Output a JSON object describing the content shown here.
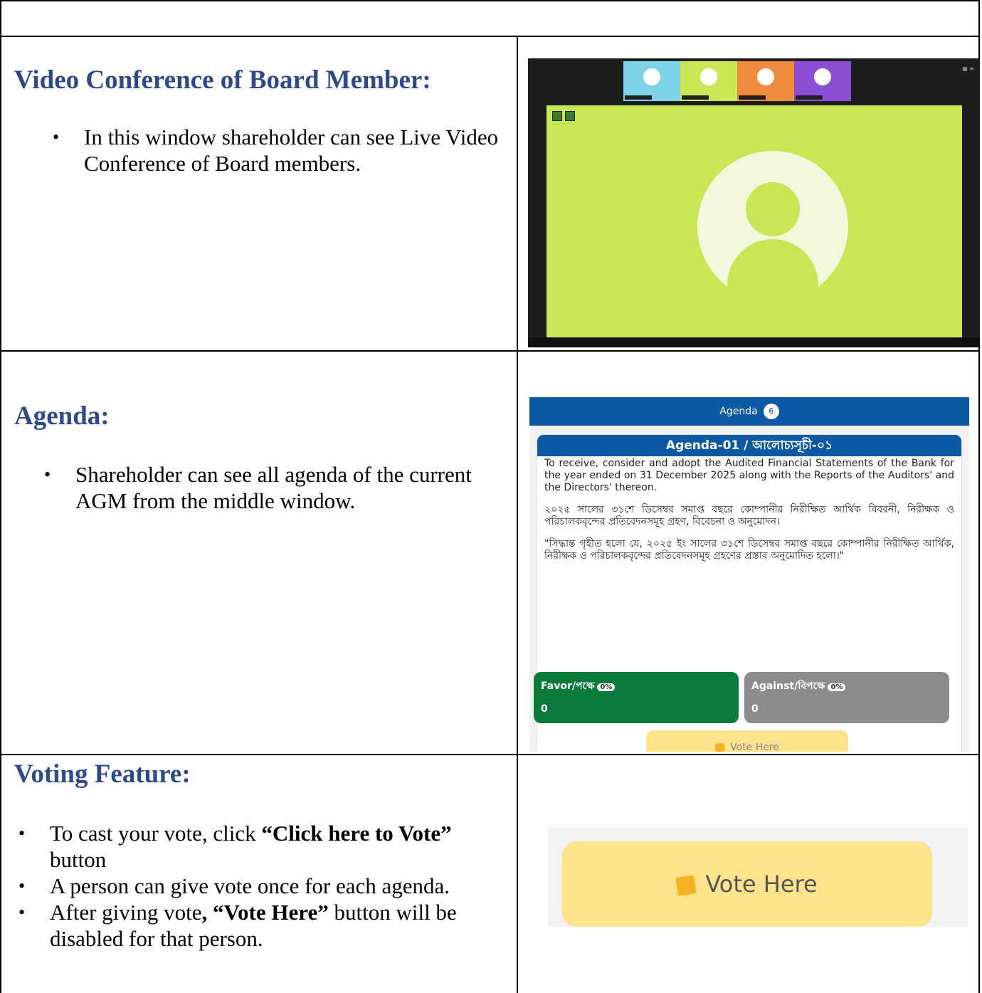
{
  "sections": [
    {
      "title": "Video Conference of Board Member:",
      "bullets": [
        "In this window shareholder can see Live Video Conference of Board members."
      ]
    },
    {
      "title": "Agenda:",
      "bullets": [
        "Shareholder can see all agenda of the current AGM from the middle window."
      ]
    },
    {
      "title": "Voting Feature:",
      "bullets": [
        [
          "To cast your vote, click ",
          "“Click here to Vote”",
          " button"
        ],
        "A person can give vote once for each agenda.",
        [
          "After giving vote",
          ", “Vote Here”",
          " button will be disabled for that person."
        ]
      ]
    }
  ],
  "agenda_panel": {
    "header": "Agenda",
    "header_badge": "6",
    "card_title": "Agenda-01 / আলোচ্যসূচী-০১",
    "paragraph_en": "To receive, consider and adopt the Audited Financial Statements of the Bank for the year ended on 31 December 2025 along with the Reports of the Auditors' and the Directors' thereon.",
    "paragraph_bn": "২০২৫ সালের ৩১শে ডিসেম্বর সমাপ্ত বছরে কোম্পানীর নিরীক্ষিত আর্থিক বিবরনী, নিরীক্ষক ও পরিচালকবৃন্দের প্রতিবেদনসমূহ গ্রহণ, বিবেচনা ও অনুমোদন।",
    "resolution_bn": "\"সিদ্ধান্ত গৃহীত হলো যে, ২০২৫ ইং সালের ৩১শে ডিসেম্বর সমাপ্ত বছরে কোম্পানীর নিরীক্ষিত আর্থিক, নিরীক্ষক ও পরিচালকবৃন্দের প্রতিবেদনসমূহ গ্রহণের প্রস্তাব অনুমোদিত হলো।\"",
    "favor_label": "Favor/পক্ষে",
    "favor_pct": "0%",
    "favor_count": "0",
    "against_label": "Against/বিপক্ষে",
    "against_pct": "0%",
    "against_count": "0",
    "vote_button": "Vote Here"
  },
  "video_panel": {
    "tile_colors": [
      "#7fd3e8",
      "#c9e654",
      "#f08a3c",
      "#8a4fd6"
    ],
    "stage_color": "#c9e654"
  },
  "big_vote_button": "Vote Here"
}
